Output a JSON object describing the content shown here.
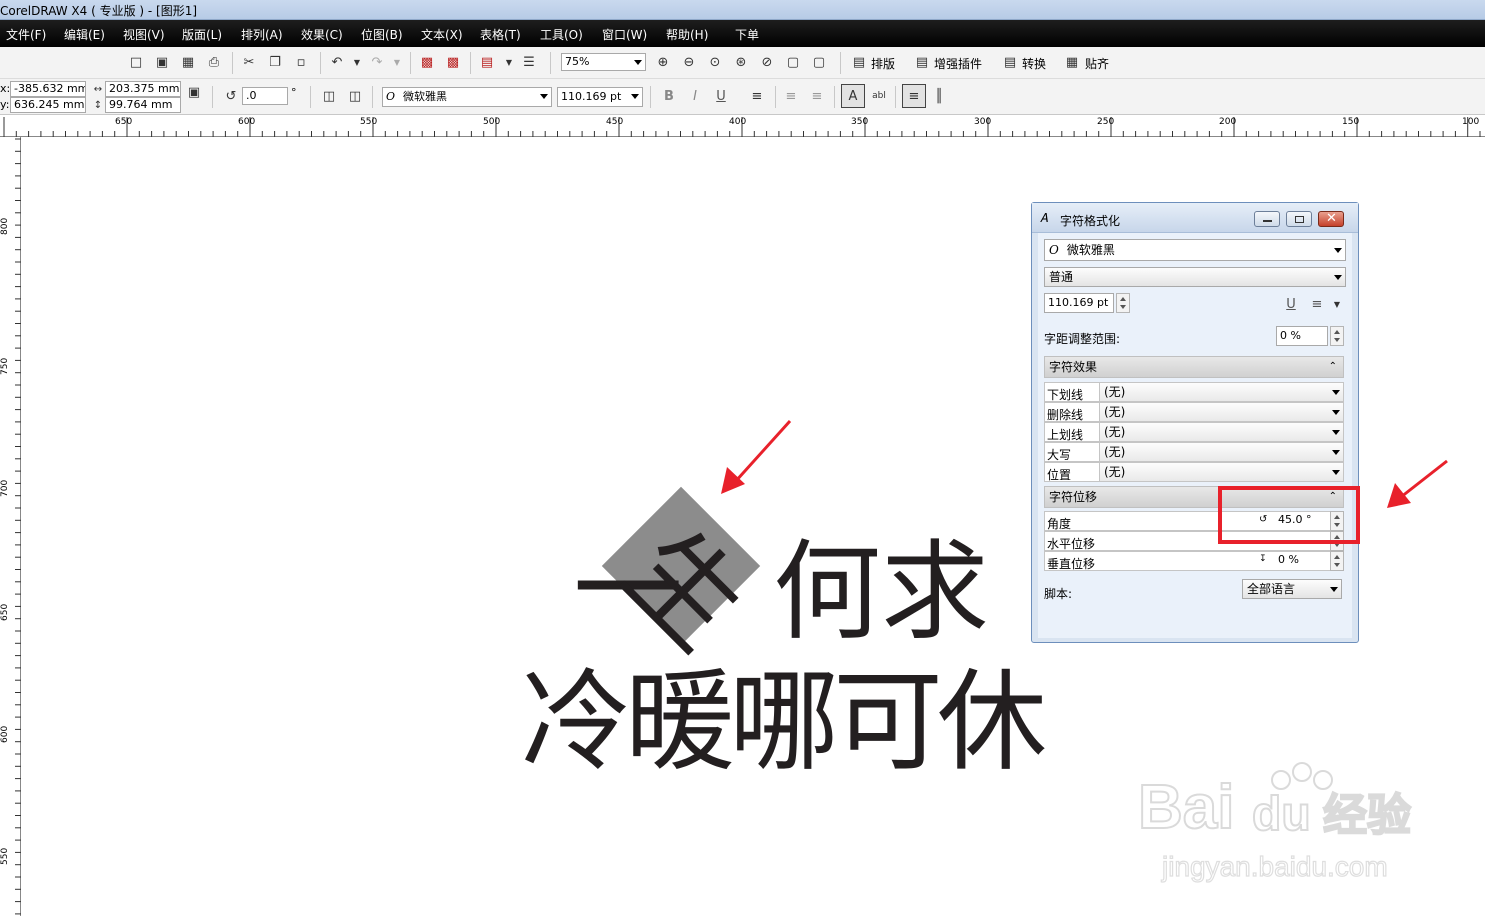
{
  "window": {
    "title": "CorelDRAW X4 ( 专业版 ) - [图形1]"
  },
  "menu": [
    "文件(F)",
    "编辑(E)",
    "视图(V)",
    "版面(L)",
    "排列(A)",
    "效果(C)",
    "位图(B)",
    "文本(X)",
    "表格(T)",
    "工具(O)",
    "窗口(W)",
    "帮助(H)",
    "下单"
  ],
  "toolbar1": {
    "zoom": "75%",
    "buttons": [
      "排版",
      "增强插件",
      "转换",
      "贴齐"
    ]
  },
  "propbar": {
    "x_label": "x:",
    "x_value": "-385.632 mm",
    "y_label": "y:",
    "y_value": "636.245 mm",
    "w_value": "203.375 mm",
    "h_value": "99.764 mm",
    "angle_value": ".0",
    "angle_unit": "°",
    "font": "微软雅黑",
    "font_size": "110.169 pt"
  },
  "ruler": {
    "h_ticks": [
      "650",
      "600",
      "550",
      "500",
      "450",
      "400",
      "350",
      "300",
      "250",
      "200",
      "150",
      "100"
    ],
    "v_ticks": [
      "800",
      "750",
      "700",
      "650",
      "600",
      "550"
    ]
  },
  "canvas": {
    "line1_rotated": "生",
    "line1_left": "一",
    "line1_rest": "何求",
    "line2": "冷暖哪可休"
  },
  "docker": {
    "title": "字符格式化",
    "font": "微软雅黑",
    "style": "普通",
    "size": "110.169 pt",
    "kerning_label": "字距调整范围:",
    "kerning_value": "0 %",
    "effects_header": "字符效果",
    "effects": [
      {
        "label": "下划线",
        "value": "(无)"
      },
      {
        "label": "删除线",
        "value": "(无)"
      },
      {
        "label": "上划线",
        "value": "(无)"
      },
      {
        "label": "大写",
        "value": "(无)"
      },
      {
        "label": "位置",
        "value": "(无)"
      }
    ],
    "shift_header": "字符位移",
    "shift": [
      {
        "label": "角度",
        "value": "45.0 °"
      },
      {
        "label": "水平位移",
        "value": ""
      },
      {
        "label": "垂直位移",
        "value": "0 %"
      }
    ],
    "script_label": "脚本:",
    "script_value": "全部语言"
  },
  "colors": {
    "highlight": "#e8212b",
    "arrow": "#e8212b",
    "text": "#231f20",
    "selection_box": "#8c8c8c"
  }
}
